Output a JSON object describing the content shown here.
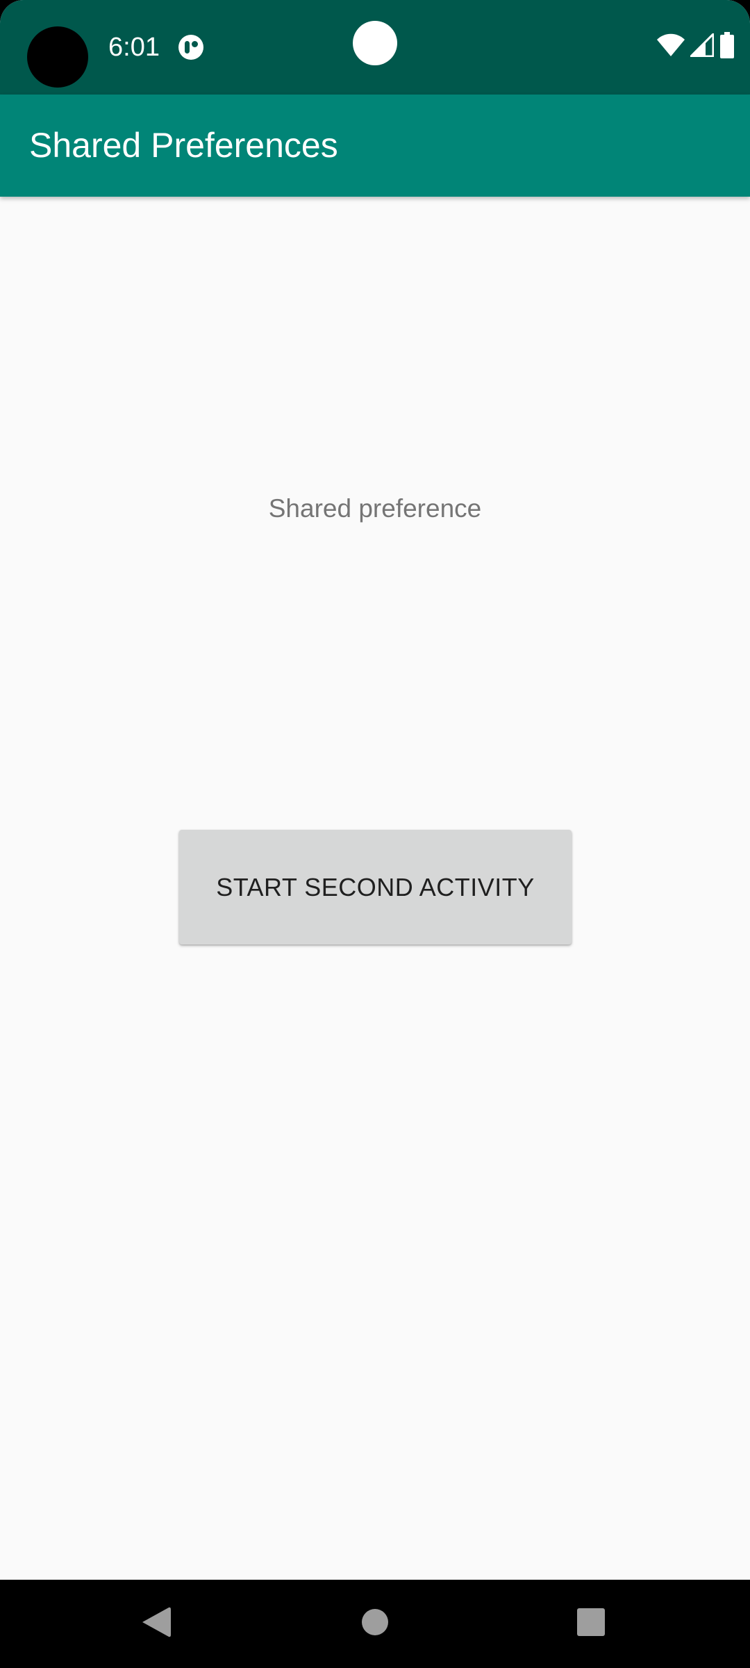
{
  "status_bar": {
    "time": "6:01",
    "notification_icon": "data-saver-icon",
    "icons": [
      "wifi-icon",
      "cellular-signal-icon",
      "battery-icon"
    ],
    "background": "#00584c"
  },
  "app_bar": {
    "title": "Shared Preferences",
    "background": "#018577"
  },
  "main": {
    "label": "Shared preference",
    "button_label": "START SECOND ACTIVITY"
  },
  "nav_bar": {
    "buttons": [
      "back-icon",
      "home-icon",
      "recents-icon"
    ]
  }
}
